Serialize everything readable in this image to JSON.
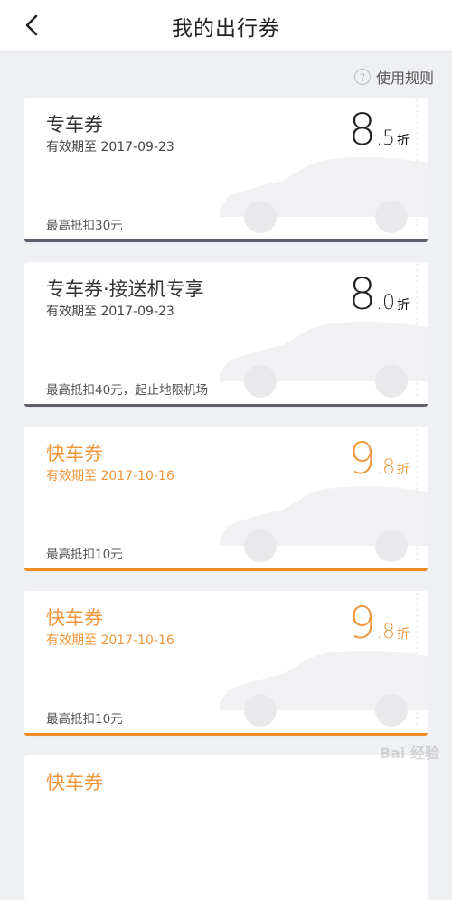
{
  "header": {
    "title": "我的出行券"
  },
  "rules_label": "使用规则",
  "cards": [
    {
      "name": "专车券",
      "valid": "有效期至 2017-09-23",
      "discount_int": "8",
      "discount_dec": ".5",
      "unit": "折",
      "limit": "最高抵扣30元"
    },
    {
      "name": "专车券·接送机专享",
      "valid": "有效期至 2017-09-23",
      "discount_int": "8",
      "discount_dec": ".0",
      "unit": "折",
      "limit": "最高抵扣40元，起止地限机场"
    },
    {
      "name": "快车券",
      "valid": "有效期至 2017-10-16",
      "discount_int": "9",
      "discount_dec": ".8",
      "unit": "折",
      "limit": "最高抵扣10元"
    },
    {
      "name": "快车券",
      "valid": "有效期至 2017-10-16",
      "discount_int": "9",
      "discount_dec": ".8",
      "unit": "折",
      "limit": "最高抵扣10元"
    },
    {
      "name": "快车券"
    }
  ],
  "watermark": "Bai 经验",
  "colors": {
    "special_accent": "#5e5f6b",
    "fast_accent": "#f08d27",
    "fast_text": "#f0973d",
    "background": "#eff0f4"
  }
}
